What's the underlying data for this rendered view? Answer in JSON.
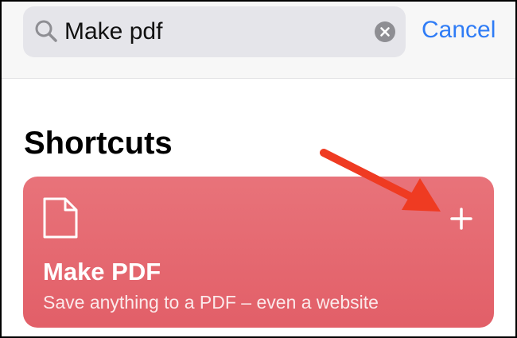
{
  "search": {
    "value": "Make pdf",
    "clear_icon": "clear-circle-icon",
    "cancel_label": "Cancel"
  },
  "section": {
    "title": "Shortcuts"
  },
  "shortcut": {
    "title": "Make PDF",
    "subtitle": "Save anything to a PDF – even a website",
    "icon": "document-icon",
    "add_icon": "plus-icon",
    "color": "#e56870"
  },
  "annotation": {
    "icon": "arrow-icon",
    "color": "#ef3b22"
  },
  "colors": {
    "accent": "#2f7cf6",
    "search_field": "#e5e5ea",
    "card": "#e56870"
  }
}
